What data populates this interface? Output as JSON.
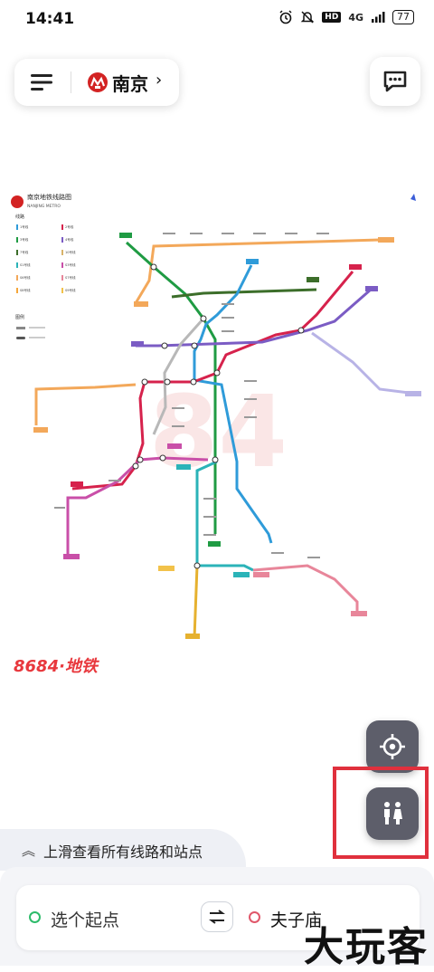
{
  "status_bar": {
    "time": "14:41",
    "hd": "HD",
    "network": "4G",
    "battery": "77"
  },
  "header": {
    "city": "南京",
    "chevron": "›"
  },
  "map": {
    "title": "南京地铁线路图",
    "subtitle": "NANJING METRO",
    "legend_header": "线路",
    "legend_header2": "图例",
    "brand": "8684·地铁",
    "line_labels": [
      "1号线",
      "2号线",
      "3号线",
      "4号线",
      "7号线",
      "10号线",
      "S1号线",
      "S3号线",
      "S6号线",
      "S7号线",
      "S8号线",
      "S9号线"
    ],
    "colors": {
      "line1": "#2f9bd9",
      "line2": "#d6224c",
      "line3": "#1f9b43",
      "line4": "#7b5cc4",
      "line7": "#3c6e2a",
      "line10": "#d8b36a",
      "s1": "#2bb3b8",
      "s3": "#c94fa8",
      "s6": "#f3a85a",
      "s7": "#e8869a",
      "s8": "#f5a63a",
      "s9": "#f2c24a",
      "yellow": "#e6b12f",
      "lavender": "#b8b3e6",
      "gray": "#b8b8b8"
    }
  },
  "controls": {
    "locate_icon": "locate-icon",
    "restroom_icon": "restroom-icon"
  },
  "bottom": {
    "slide_hint": "上滑查看所有线路和站点",
    "start_placeholder": "选个起点",
    "end_value": "夫子庙"
  },
  "watermark": "大玩客"
}
